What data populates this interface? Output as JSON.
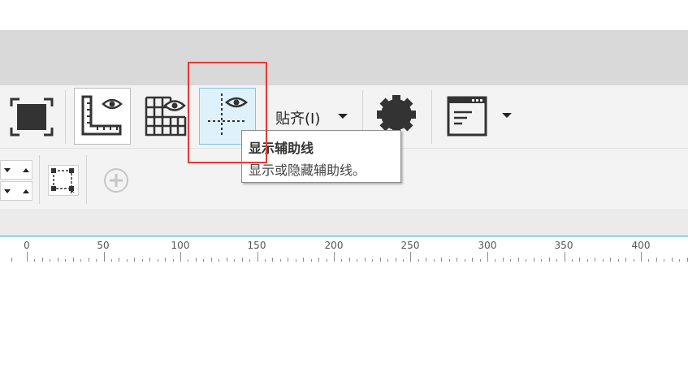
{
  "toolbar": {
    "snap": {
      "label": "贴齐(I)"
    }
  },
  "tooltip": {
    "title": "显示辅助线",
    "description": "显示或隐藏辅助线。"
  },
  "ruler": {
    "labels": [
      "0",
      "50",
      "100",
      "150",
      "200",
      "250",
      "300",
      "350",
      "400"
    ]
  },
  "colors": {
    "highlight": "#e53935",
    "active_button_bg": "#dff1fb",
    "active_button_border": "#7cc6e6",
    "ruler_line": "#27a9c7",
    "icon_dark": "#333333"
  },
  "icons": {
    "fullscreen": "fullscreen-icon",
    "rulers": "show-rulers-icon",
    "grid": "show-grid-icon",
    "guidelines": "show-guidelines-icon",
    "snap_dropdown": "chevron-down-icon",
    "options": "gear-icon",
    "application_window": "window-icon",
    "transform": "transform-icon",
    "add": "plus-circle-icon"
  }
}
